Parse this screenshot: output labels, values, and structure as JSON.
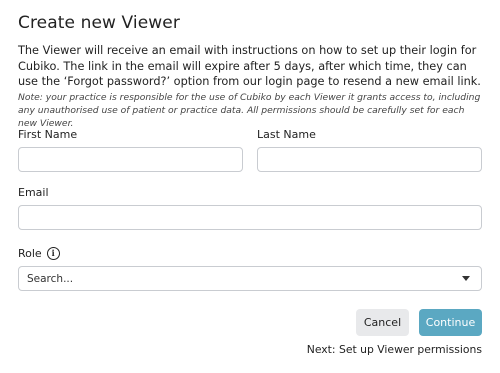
{
  "dialog": {
    "title": "Create new Viewer",
    "intro": "The Viewer will receive an email with instructions on how to set up their login for Cubiko. The link in the email will expire after 5 days, after which time, they can use the ‘Forgot password?’ option from our login page to resend a new email link.",
    "note": "Note: your practice is responsible for the use of Cubiko by each Viewer it grants access to, including any unauthorised use of patient or practice data. All permissions should be carefully set for each new Viewer."
  },
  "form": {
    "first_name": {
      "label": "First Name",
      "value": ""
    },
    "last_name": {
      "label": "Last Name",
      "value": ""
    },
    "email": {
      "label": "Email",
      "value": ""
    },
    "role": {
      "label": "Role",
      "selected": "Search..."
    }
  },
  "actions": {
    "cancel_label": "Cancel",
    "continue_label": "Continue",
    "next_step": "Next: Set up Viewer permissions"
  },
  "icons": {
    "info": "info-circle-icon",
    "dropdown": "caret-down-icon"
  },
  "colors": {
    "primary": "#5ba8c2",
    "secondary_button": "#e8e9eb",
    "border": "#c9ccd1"
  }
}
